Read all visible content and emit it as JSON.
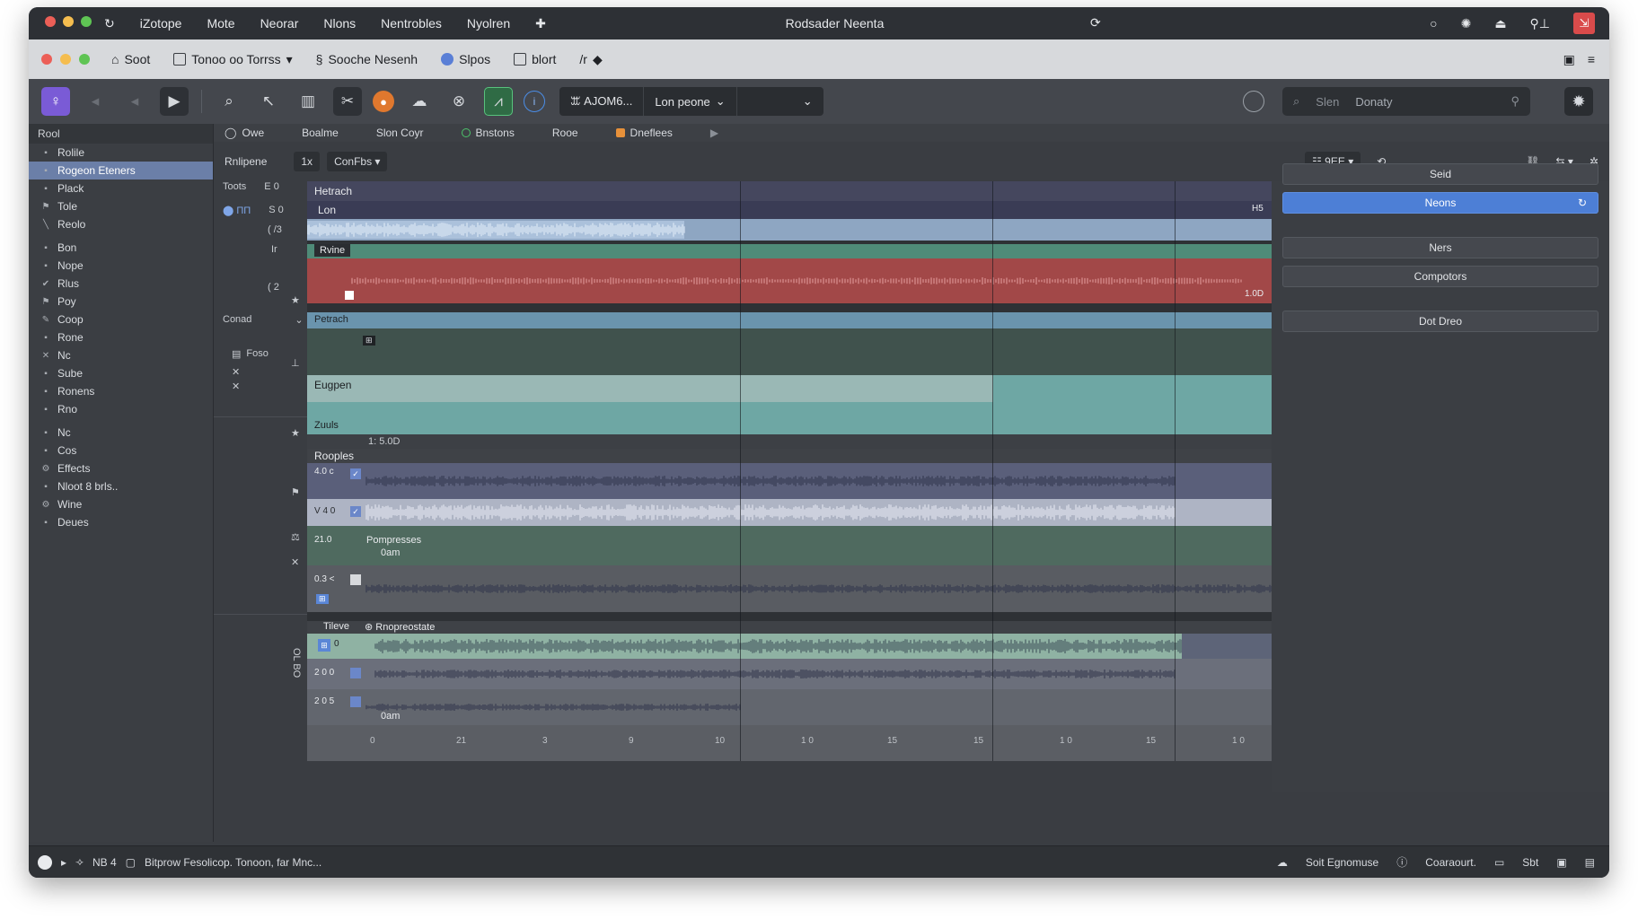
{
  "menubar": {
    "app_name": "iZotope",
    "items": [
      "Mote",
      "Neorar",
      "Nlons",
      "Nentrobles",
      "Nyolren"
    ],
    "window_title": "Rodsader Neenta"
  },
  "tabbar": {
    "tabs": [
      {
        "icon": "home-icon",
        "label": "Soot"
      },
      {
        "icon": "square-icon",
        "label": "Tonoo oo Torrss"
      },
      {
        "icon": "link-icon",
        "label": "Sooche Nesenh"
      },
      {
        "icon": "globe-icon",
        "label": "Slpos"
      },
      {
        "icon": "square-icon",
        "label": "blort"
      },
      {
        "icon": "pen-icon",
        "label": "/r"
      }
    ]
  },
  "toolbar": {
    "dropdowns": [
      "ꕭ AJOM6...",
      "Lon peone",
      ""
    ],
    "search_placeholder": "Slen",
    "search_value": "Donaty"
  },
  "sidebar": {
    "header": "Rool",
    "items": [
      {
        "label": "Rolile",
        "icon": "file-icon"
      },
      {
        "label": "Rogeon Eteners",
        "icon": "file-icon",
        "active": true
      },
      {
        "label": "Plack",
        "icon": "file-icon"
      },
      {
        "label": "Tole",
        "icon": "flag-icon"
      },
      {
        "label": "Reolo",
        "icon": "slash-icon"
      },
      {
        "label": "Bon",
        "icon": "file-icon"
      },
      {
        "label": "Nope",
        "icon": "file-icon"
      },
      {
        "label": "Rlus",
        "icon": "check-icon"
      },
      {
        "label": "Poy",
        "icon": "flag-icon"
      },
      {
        "label": "Coop",
        "icon": "pen-icon"
      },
      {
        "label": "Rone",
        "icon": "file-icon"
      },
      {
        "label": "Nc",
        "icon": "cross-icon"
      },
      {
        "label": "Sube",
        "icon": "file-icon"
      },
      {
        "label": "Ronens",
        "icon": "file-icon"
      },
      {
        "label": "Rno",
        "icon": "file-icon"
      },
      {
        "label": "Nc",
        "icon": "file-icon"
      },
      {
        "label": "Cos",
        "icon": "file-icon"
      },
      {
        "label": "Effects",
        "icon": "gear-icon"
      },
      {
        "label": "Nloot 8 brls..",
        "icon": "file-icon"
      },
      {
        "label": "Wine",
        "icon": "gear-icon"
      },
      {
        "label": "Deues",
        "icon": "file-icon"
      }
    ]
  },
  "content_head": {
    "items": [
      "Owe",
      "Boalme",
      "Slon Coyr",
      "Bnstons",
      "Rooe",
      "Dneflees"
    ]
  },
  "sub_head": {
    "label": "Rnlipene",
    "pill1": "1x",
    "pill2": "ConFbs",
    "right_box": "9EE"
  },
  "track_controls": {
    "rows": [
      {
        "a": "Toots",
        "b": "E 0"
      },
      {
        "a": "⬤ ΠΠ",
        "b": "S 0"
      },
      {
        "a": "",
        "b": "( /3"
      },
      {
        "a": "",
        "b": "Ir"
      },
      {
        "a": "",
        "b": "( 2"
      },
      {
        "a": "Conad",
        "b": ""
      },
      {
        "a": "Foso",
        "b": ""
      }
    ]
  },
  "lanes": {
    "lane1_title": "Hetrach",
    "lane1_sub": "Lon",
    "lane1_end": "H5",
    "lane2_title": "Rvine",
    "lane2_end": "1.0D",
    "lane3_title": "Petrach",
    "lane4_title": "Eugpen",
    "lane4_sub": "Zuuls",
    "lane5_meta": "1: 5.0D",
    "lane5_title": "Rooples",
    "lane5_rows": [
      "4.0 c",
      "V 4 0",
      "21.0",
      "0.3 <"
    ],
    "lane5_sub": "Pompresses",
    "lane5_sub2": "0am",
    "lane6_title": "Tileve",
    "lane6_sub": "Rnopreostate",
    "lane6_rows": [
      "0",
      "2 0 0",
      "2 0 5"
    ],
    "lane6_sub2": "0am"
  },
  "ruler": {
    "ticks": [
      "0",
      "21",
      "3",
      "9",
      "10",
      "1 0",
      "15",
      "15",
      "1 0",
      "15",
      "1 0"
    ]
  },
  "rpanel": {
    "buttons": [
      "Seid",
      "Neons",
      "Ners",
      "Compotors",
      "Dot Dreo"
    ]
  },
  "status": {
    "left_text": "NB 4",
    "message": "Bitprow Fesolicop. Tonoon, far Mnc...",
    "right_items": [
      "Soit Egnomuse",
      "Coaraourt.",
      "Sbt"
    ]
  },
  "colors": {
    "accent_blue": "#4d7fd6",
    "waveform_light": "#9cb6d6",
    "lane_red": "#a84a4a",
    "lane_teal": "#6aa6a4"
  }
}
